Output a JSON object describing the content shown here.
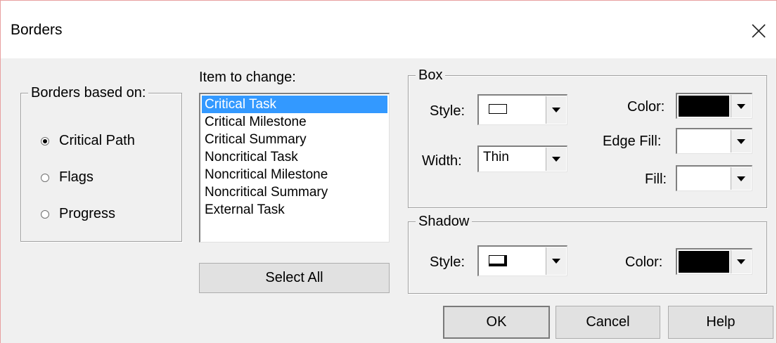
{
  "window": {
    "title": "Borders",
    "close_icon": "close-icon"
  },
  "borders_based_on": {
    "legend": "Borders based on:",
    "options": [
      {
        "label": "Critical Path",
        "selected": true
      },
      {
        "label": "Flags",
        "selected": false
      },
      {
        "label": "Progress",
        "selected": false
      }
    ]
  },
  "item_to_change": {
    "label": "Item to change:",
    "items": [
      {
        "label": "Critical Task",
        "selected": true
      },
      {
        "label": "Critical Milestone",
        "selected": false
      },
      {
        "label": "Critical Summary",
        "selected": false
      },
      {
        "label": "Noncritical Task",
        "selected": false
      },
      {
        "label": "Noncritical Milestone",
        "selected": false
      },
      {
        "label": "Noncritical Summary",
        "selected": false
      },
      {
        "label": "External Task",
        "selected": false
      }
    ],
    "select_all_label": "Select All"
  },
  "box": {
    "legend": "Box",
    "style_label": "Style:",
    "width_label": "Width:",
    "width_value": "Thin",
    "color_label": "Color:",
    "color_value": "#000000",
    "edge_fill_label": "Edge Fill:",
    "edge_fill_value": "#ffffff",
    "fill_label": "Fill:",
    "fill_value": "#ffffff"
  },
  "shadow": {
    "legend": "Shadow",
    "style_label": "Style:",
    "color_label": "Color:",
    "color_value": "#000000"
  },
  "buttons": {
    "ok": "OK",
    "cancel": "Cancel",
    "help": "Help"
  },
  "colors": {
    "selection": "#3399ff",
    "dialog_bg": "#f0f0f0"
  }
}
